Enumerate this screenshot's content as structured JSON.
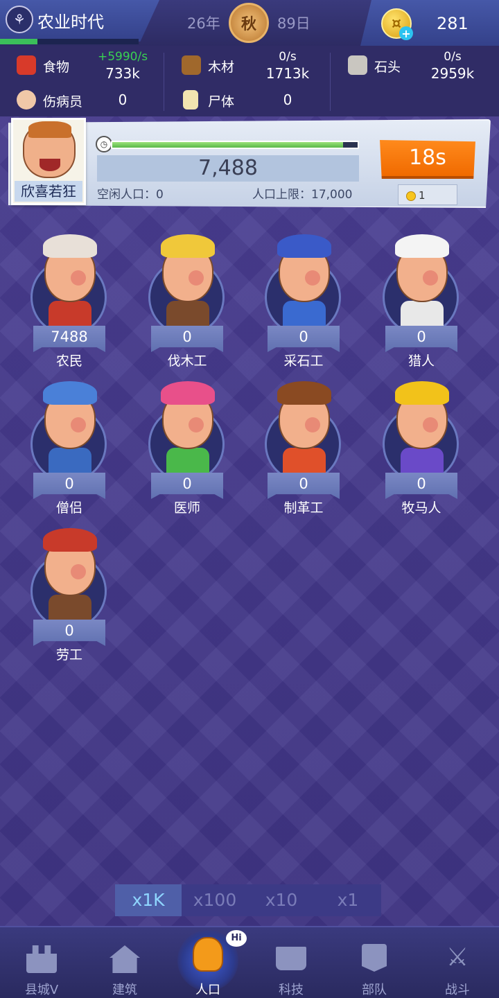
{
  "header": {
    "era_title": "农业时代",
    "era_progress": 0.27,
    "year": "26年",
    "season": "秋",
    "day": "89日",
    "coins": "281",
    "icons": {
      "era": "wheat-icon",
      "season": "season-badge-icon",
      "coin": "gold-coin-icon",
      "add": "plus-icon"
    }
  },
  "resources": {
    "food": {
      "label": "食物",
      "rate": "+5990/s",
      "value": "733k",
      "rate_color": "#39d152",
      "icon": "meat-icon"
    },
    "wood": {
      "label": "木材",
      "rate": "0/s",
      "value": "1713k",
      "icon": "log-icon"
    },
    "stone": {
      "label": "石头",
      "rate": "0/s",
      "value": "2959k",
      "icon": "rock-icon"
    },
    "wounded": {
      "label": "伤病员",
      "value": "0",
      "icon": "injured-person-icon"
    },
    "corpse": {
      "label": "尸体",
      "value": "0",
      "icon": "coffin-icon"
    }
  },
  "population": {
    "portrait_label": "欣喜若狂",
    "progress": 0.94,
    "count": "7,488",
    "idle_label": "空闲人口：0",
    "cap_label": "人口上限：17,000",
    "timer": "18s",
    "cost": "1"
  },
  "workers": [
    {
      "name": "农民",
      "count": "7488",
      "hair": "#e8e0d8",
      "body": "#c83a2a"
    },
    {
      "name": "伐木工",
      "count": "0",
      "hair": "#f0c83a",
      "body": "#7a4a2c"
    },
    {
      "name": "采石工",
      "count": "0",
      "hair": "#3a5ac8",
      "body": "#3a6ad0"
    },
    {
      "name": "猎人",
      "count": "0",
      "hair": "#f4f4f4",
      "body": "#e8e8e8"
    },
    {
      "name": "僧侣",
      "count": "0",
      "hair": "#4a80d8",
      "body": "#3a6ac0"
    },
    {
      "name": "医师",
      "count": "0",
      "hair": "#e8508a",
      "body": "#4ab84a"
    },
    {
      "name": "制革工",
      "count": "0",
      "hair": "#8a4a22",
      "body": "#e0502a"
    },
    {
      "name": "牧马人",
      "count": "0",
      "hair": "#f2c21a",
      "body": "#6a4ac8"
    },
    {
      "name": "劳工",
      "count": "0",
      "hair": "#c83a2a",
      "body": "#7a4a2c"
    }
  ],
  "multiplier": {
    "options": [
      "x1K",
      "x100",
      "x10",
      "x1"
    ],
    "selected": "x1K"
  },
  "nav": {
    "items": [
      {
        "label": "县城V",
        "icon": "castle-icon"
      },
      {
        "label": "建筑",
        "icon": "house-icon"
      },
      {
        "label": "人口",
        "icon": "gingerbread-person-icon",
        "badge": "Hi"
      },
      {
        "label": "科技",
        "icon": "book-icon"
      },
      {
        "label": "部队",
        "icon": "banner-icon"
      },
      {
        "label": "战斗",
        "icon": "crossed-swords-icon"
      }
    ],
    "active": "人口"
  }
}
